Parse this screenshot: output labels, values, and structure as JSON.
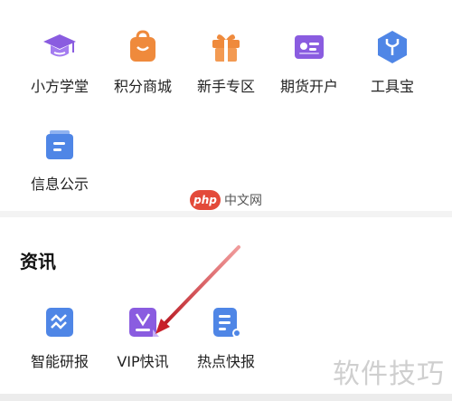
{
  "services": {
    "items": [
      {
        "label": "小方学堂",
        "icon": "graduation-cap-icon"
      },
      {
        "label": "积分商城",
        "icon": "shopping-bag-icon"
      },
      {
        "label": "新手专区",
        "icon": "gift-box-icon"
      },
      {
        "label": "期货开户",
        "icon": "id-card-icon"
      },
      {
        "label": "工具宝",
        "icon": "toolbox-shield-icon"
      },
      {
        "label": "信息公示",
        "icon": "notice-board-icon"
      }
    ]
  },
  "news": {
    "title": "资讯",
    "items": [
      {
        "label": "智能研报",
        "icon": "research-report-icon"
      },
      {
        "label": "VIP快讯",
        "icon": "vip-news-icon"
      },
      {
        "label": "热点快报",
        "icon": "hot-news-icon"
      }
    ]
  },
  "watermarks": {
    "php_badge": "php",
    "php_text": "中文网",
    "corner_text": "软件技巧"
  },
  "colors": {
    "purple": "#8a5ce0",
    "orange": "#ef8a3c",
    "blue": "#4f86e6",
    "annotation_red": "#c8202a"
  }
}
